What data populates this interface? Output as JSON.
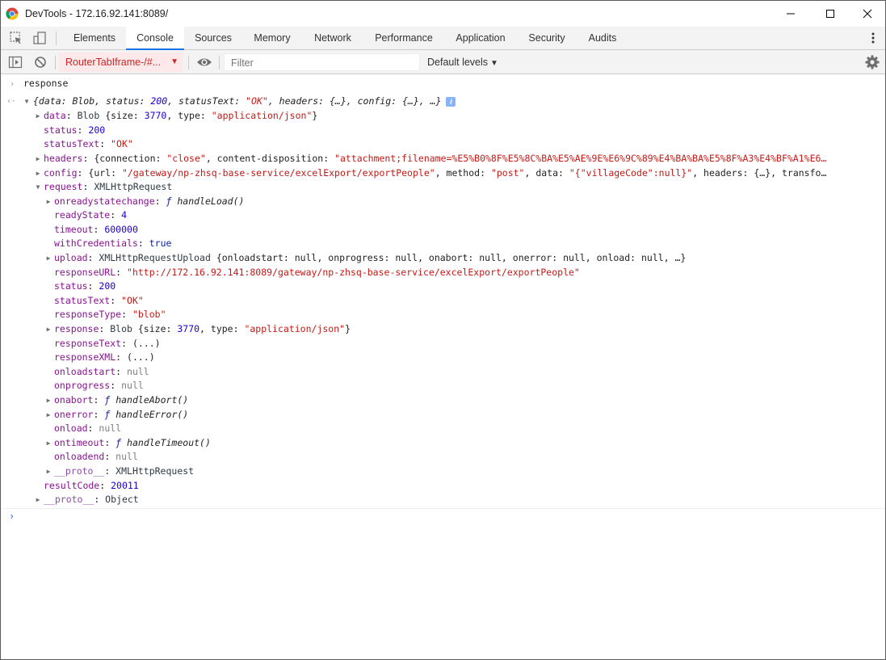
{
  "window": {
    "title": "DevTools - 172.16.92.141:8089/"
  },
  "tabs": [
    "Elements",
    "Console",
    "Sources",
    "Memory",
    "Network",
    "Performance",
    "Application",
    "Security",
    "Audits"
  ],
  "active_tab": "Console",
  "toolbar": {
    "context": "RouterTabIframe-/#...",
    "filter_placeholder": "Filter",
    "levels": "Default levels"
  },
  "console": {
    "input_command": "response",
    "object_summary": {
      "open": "{data: Blob, status: ",
      "status": "200",
      "mid": ", statusText: ",
      "status_text": "\"OK\"",
      "tail": ", headers: {…}, config: {…}, …}",
      "badge": "i"
    },
    "data_line": {
      "key": "data",
      "type": "Blob",
      "p1": " {size: ",
      "size": "3770",
      "p2": ", type: ",
      "mime": "\"application/json\"",
      "p3": "}"
    },
    "status_line": {
      "key": "status",
      "value": "200"
    },
    "statusText_line": {
      "key": "statusText",
      "value": "\"OK\""
    },
    "headers_line": {
      "key": "headers",
      "p1": " {connection: ",
      "connection": "\"close\"",
      "p2": ", content-disposition: ",
      "disposition": "\"attachment;filename=%E5%B0%8F%E5%8C%BA%E5%AE%9E%E6%9C%89%E4%BA%BA%E5%8F%A3%E4%BF%A1%E6…"
    },
    "config_line": {
      "key": "config",
      "p1": " {url: ",
      "url": "\"/gateway/np-zhsq-base-service/excelExport/exportPeople\"",
      "p2": ", method: ",
      "method": "\"post\"",
      "p3": ", data: ",
      "data": "\"{\"villageCode\":null}\"",
      "p4": ", headers: {…}, transfo…"
    },
    "request_line": {
      "key": "request",
      "value": "XMLHttpRequest"
    },
    "request_children": {
      "onreadystatechange": {
        "key": "onreadystatechange",
        "f": "ƒ",
        "fn": "handleLoad()"
      },
      "readyState": {
        "key": "readyState",
        "value": "4"
      },
      "timeout": {
        "key": "timeout",
        "value": "600000"
      },
      "withCredentials": {
        "key": "withCredentials",
        "value": "true"
      },
      "upload": {
        "key": "upload",
        "type": "XMLHttpRequestUpload",
        "rest": " {onloadstart: null, onprogress: null, onabort: null, onerror: null, onload: null, …}"
      },
      "responseURL": {
        "key": "responseURL",
        "value": "\"http://172.16.92.141:8089/gateway/np-zhsq-base-service/excelExport/exportPeople\""
      },
      "status": {
        "key": "status",
        "value": "200"
      },
      "statusText": {
        "key": "statusText",
        "value": "\"OK\""
      },
      "responseType": {
        "key": "responseType",
        "value": "\"blob\""
      },
      "response": {
        "key": "response",
        "type": "Blob",
        "p1": " {size: ",
        "size": "3770",
        "p2": ", type: ",
        "mime": "\"application/json\"",
        "p3": "}"
      },
      "responseText": {
        "key": "responseText",
        "value": "(...)"
      },
      "responseXML": {
        "key": "responseXML",
        "value": "(...)"
      },
      "onloadstart": {
        "key": "onloadstart",
        "value": "null"
      },
      "onprogress": {
        "key": "onprogress",
        "value": "null"
      },
      "onabort": {
        "key": "onabort",
        "f": "ƒ",
        "fn": "handleAbort()"
      },
      "onerror": {
        "key": "onerror",
        "f": "ƒ",
        "fn": "handleError()"
      },
      "onload": {
        "key": "onload",
        "value": "null"
      },
      "ontimeout": {
        "key": "ontimeout",
        "f": "ƒ",
        "fn": "handleTimeout()"
      },
      "onloadend": {
        "key": "onloadend",
        "value": "null"
      },
      "proto": {
        "key": "__proto__",
        "value": "XMLHttpRequest"
      }
    },
    "resultCode_line": {
      "key": "resultCode",
      "value": "20011"
    },
    "proto_line": {
      "key": "__proto__",
      "value": "Object"
    }
  },
  "colors": {
    "accent": "#1a73e8",
    "key": "#881391",
    "string": "#c41a16",
    "number": "#1c00cf"
  },
  "icons": [
    "chrome-logo-icon",
    "minimize-icon",
    "maximize-icon",
    "close-icon",
    "inspect-element-icon",
    "device-toolbar-icon",
    "more-vert-icon",
    "sidebar-toggle-icon",
    "clear-console-icon",
    "eye-icon",
    "settings-gear-icon"
  ]
}
